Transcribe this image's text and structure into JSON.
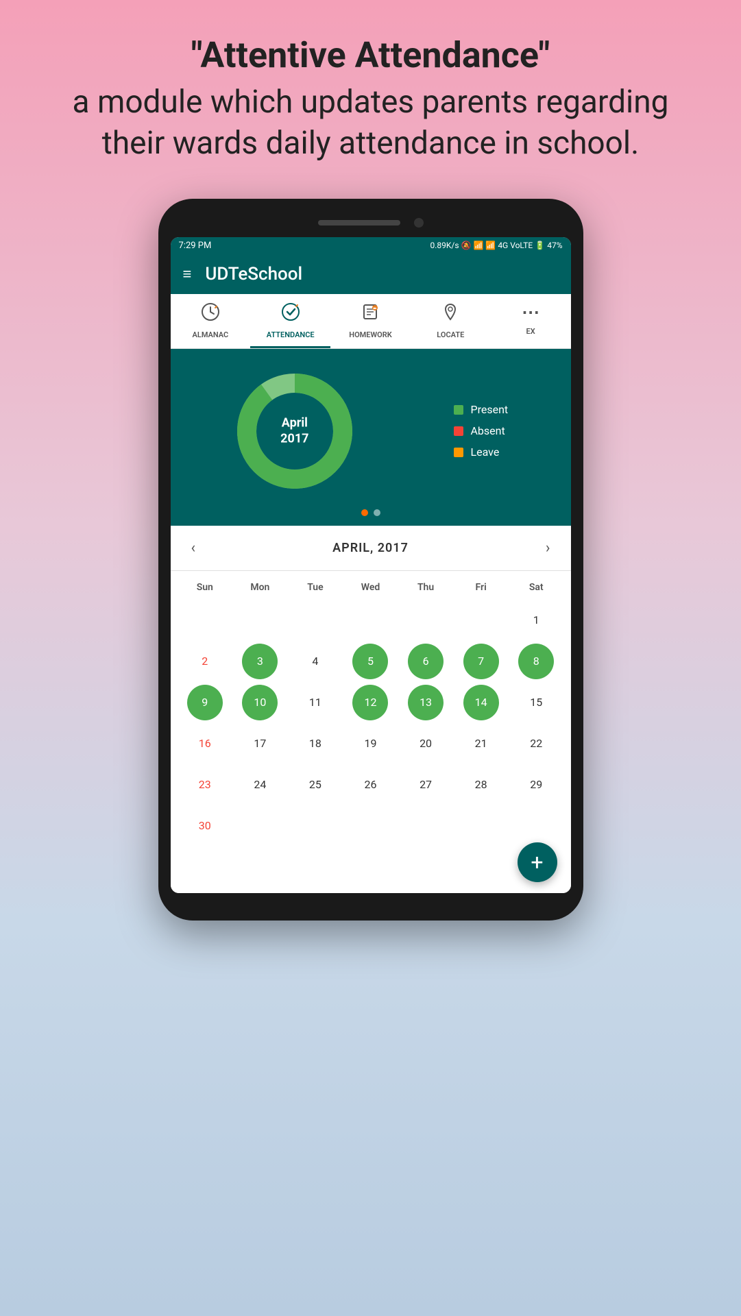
{
  "page": {
    "bg_text_line1": "\"Attentive Attendance\"",
    "bg_text_line2": "a module which updates parents regarding",
    "bg_text_line3": "their wards daily attendance in school."
  },
  "status_bar": {
    "time": "7:29 PM",
    "network_info": "0.89K/s",
    "signal": "4G VoLTE",
    "battery": "47%"
  },
  "header": {
    "title": "UDTeSchool",
    "menu_icon": "≡"
  },
  "tabs": [
    {
      "label": "ALMANAC",
      "icon": "🕐",
      "active": false
    },
    {
      "label": "ATTENDANCE",
      "icon": "✅",
      "active": true
    },
    {
      "label": "HOMEWORK",
      "icon": "📝",
      "active": false
    },
    {
      "label": "LOCATE",
      "icon": "📍",
      "active": false
    },
    {
      "label": "EX",
      "icon": "",
      "active": false
    }
  ],
  "chart": {
    "month": "April",
    "year": "2017",
    "legend": [
      {
        "label": "Present",
        "color_class": "dot-present"
      },
      {
        "label": "Absent",
        "color_class": "dot-absent"
      },
      {
        "label": "Leave",
        "color_class": "dot-leave"
      }
    ]
  },
  "calendar": {
    "title": "APRIL, 2017",
    "day_headers": [
      "Sun",
      "Mon",
      "Tue",
      "Wed",
      "Thu",
      "Fri",
      "Sat"
    ],
    "days": [
      {
        "num": "",
        "type": "empty"
      },
      {
        "num": "",
        "type": "empty"
      },
      {
        "num": "",
        "type": "empty"
      },
      {
        "num": "",
        "type": "empty"
      },
      {
        "num": "",
        "type": "empty"
      },
      {
        "num": "",
        "type": "empty"
      },
      {
        "num": "1",
        "type": "normal"
      },
      {
        "num": "2",
        "type": "sunday red"
      },
      {
        "num": "3",
        "type": "present"
      },
      {
        "num": "4",
        "type": "normal"
      },
      {
        "num": "5",
        "type": "present"
      },
      {
        "num": "6",
        "type": "present"
      },
      {
        "num": "7",
        "type": "present"
      },
      {
        "num": "8",
        "type": "present"
      },
      {
        "num": "9",
        "type": "present"
      },
      {
        "num": "10",
        "type": "present"
      },
      {
        "num": "11",
        "type": "normal"
      },
      {
        "num": "12",
        "type": "present"
      },
      {
        "num": "13",
        "type": "present"
      },
      {
        "num": "14",
        "type": "present"
      },
      {
        "num": "15",
        "type": "normal"
      },
      {
        "num": "16",
        "type": "red"
      },
      {
        "num": "17",
        "type": "normal"
      },
      {
        "num": "18",
        "type": "normal"
      },
      {
        "num": "19",
        "type": "normal"
      },
      {
        "num": "20",
        "type": "normal"
      },
      {
        "num": "21",
        "type": "normal"
      },
      {
        "num": "22",
        "type": "normal"
      },
      {
        "num": "23",
        "type": "red"
      },
      {
        "num": "24",
        "type": "normal"
      },
      {
        "num": "25",
        "type": "normal"
      },
      {
        "num": "26",
        "type": "normal"
      },
      {
        "num": "27",
        "type": "normal"
      },
      {
        "num": "28",
        "type": "normal"
      },
      {
        "num": "29",
        "type": "normal"
      },
      {
        "num": "30",
        "type": "red"
      },
      {
        "num": "",
        "type": "empty"
      },
      {
        "num": "",
        "type": "empty"
      },
      {
        "num": "",
        "type": "empty"
      },
      {
        "num": "",
        "type": "empty"
      },
      {
        "num": "",
        "type": "empty"
      }
    ]
  },
  "fab": {
    "label": "+"
  }
}
